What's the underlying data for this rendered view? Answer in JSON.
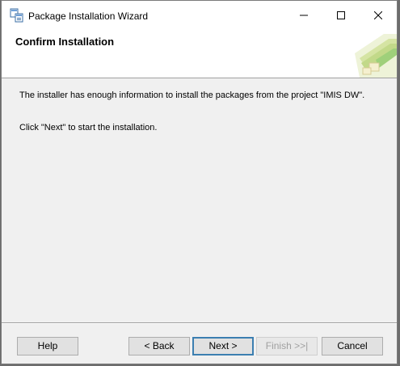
{
  "window": {
    "title": "Package Installation Wizard"
  },
  "header": {
    "title": "Confirm Installation"
  },
  "content": {
    "line1": "The installer has enough information to install the packages from the project \"IMIS DW\".",
    "line2": "Click \"Next\" to start the installation."
  },
  "buttons": {
    "help": "Help",
    "back": "< Back",
    "next": "Next >",
    "finish": "Finish >>|",
    "cancel": "Cancel"
  }
}
